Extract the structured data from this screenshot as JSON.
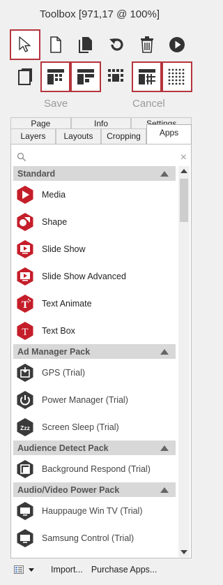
{
  "window": {
    "title": "Toolbox [971,17 @ 100%]"
  },
  "toolbar": {
    "row1": [
      {
        "icon": "pointer-icon",
        "selected": true
      },
      {
        "icon": "new-page-icon",
        "selected": false
      },
      {
        "icon": "duplicate-page-icon",
        "selected": false
      },
      {
        "icon": "undo-icon",
        "selected": false
      },
      {
        "icon": "trash-icon",
        "selected": false
      },
      {
        "icon": "play-icon",
        "selected": false
      }
    ],
    "row2": [
      {
        "icon": "layer-toggle-icon",
        "selected": false
      },
      {
        "icon": "grid-layout-a-icon",
        "selected": true
      },
      {
        "icon": "grid-layout-b-icon",
        "selected": true
      },
      {
        "icon": "dotted-frame-icon",
        "selected": false
      },
      {
        "icon": "snap-grid-icon",
        "selected": true
      },
      {
        "icon": "dot-grid-icon",
        "selected": true
      }
    ],
    "save_label": "Save",
    "cancel_label": "Cancel"
  },
  "tabs": {
    "row1": [
      "Page",
      "Info",
      "Settings"
    ],
    "row2": [
      "Layers",
      "Layouts",
      "Cropping",
      "Apps"
    ],
    "active": "Apps"
  },
  "search": {
    "placeholder": "",
    "clear": "×"
  },
  "sections": [
    {
      "title": "Standard",
      "items": [
        {
          "label": "Media",
          "icon": "media-icon",
          "trial": false
        },
        {
          "label": "Shape",
          "icon": "shape-icon",
          "trial": false
        },
        {
          "label": "Slide Show",
          "icon": "slide-show-icon",
          "trial": false
        },
        {
          "label": "Slide Show Advanced",
          "icon": "slide-show-advanced-icon",
          "trial": false
        },
        {
          "label": "Text Animate",
          "icon": "text-animate-icon",
          "trial": false
        },
        {
          "label": "Text Box",
          "icon": "text-box-icon",
          "trial": false
        }
      ]
    },
    {
      "title": "Ad Manager Pack",
      "items": [
        {
          "label": "GPS (Trial)",
          "icon": "gps-icon",
          "trial": true
        },
        {
          "label": "Power Manager (Trial)",
          "icon": "power-icon",
          "trial": true
        },
        {
          "label": "Screen Sleep (Trial)",
          "icon": "screen-sleep-icon",
          "trial": true
        }
      ]
    },
    {
      "title": "Audience Detect Pack",
      "items": [
        {
          "label": "Background Respond (Trial)",
          "icon": "background-respond-icon",
          "trial": true
        }
      ]
    },
    {
      "title": "Audio/Video Power Pack",
      "items": [
        {
          "label": "Hauppauge Win TV (Trial)",
          "icon": "tv-icon",
          "trial": true
        },
        {
          "label": "Samsung Control (Trial)",
          "icon": "monitor-icon",
          "trial": true
        }
      ]
    }
  ],
  "footer": {
    "import_label": "Import...",
    "purchase_label": "Purchase Apps..."
  },
  "colors": {
    "accent": "#c41e2a",
    "trial_icon": "#3a3a3a",
    "selected_border": "#b5353d"
  }
}
